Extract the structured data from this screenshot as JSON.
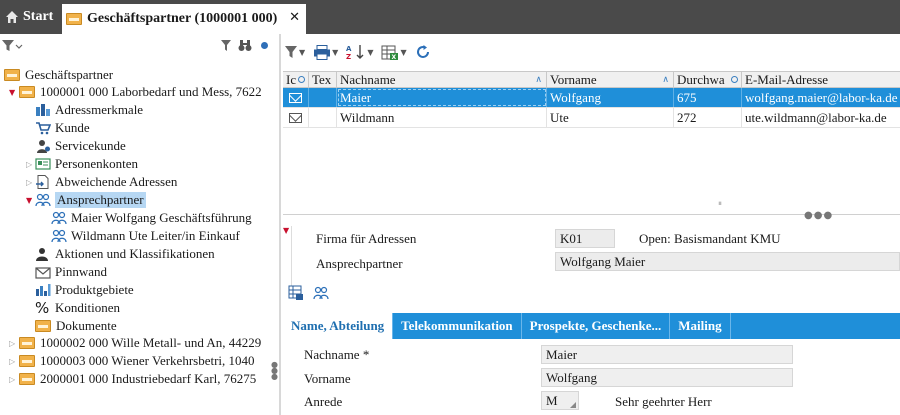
{
  "tabs": {
    "start_label": "Start",
    "active_label": "Geschäftspartner (1000001 000)",
    "close_glyph": "✕"
  },
  "tree": {
    "root": "Geschäftspartner",
    "partner1": "1000001  000  Laborbedarf und Mess, 7622",
    "children": {
      "adressmerkmale": "Adressmerkmale",
      "kunde": "Kunde",
      "servicekunde": "Servicekunde",
      "personenkonten": "Personenkonten",
      "abweichende_adressen": "Abweichende Adressen",
      "ansprechpartner": "Ansprechpartner",
      "contact1": "Maier  Wolfgang  Geschäftsführung",
      "contact2": "Wildmann  Ute  Leiter/in Einkauf",
      "aktionen": "Aktionen und Klassifikationen",
      "pinnwand": "Pinnwand",
      "produktgebiete": "Produktgebiete",
      "konditionen": "Konditionen",
      "dokumente": "Dokumente"
    },
    "partner2": "1000002  000  Wille Metall- und An, 44229",
    "partner3": "1000003  000  Wiener Verkehrsbetri, 1040",
    "partner4": "2000001  000  Industriebedarf Karl, 76275"
  },
  "grid": {
    "headers": {
      "ic": "Ic",
      "tex": "Tex",
      "nachname": "Nachname",
      "vorname": "Vorname",
      "durchwahl": "Durchwa",
      "email": "E-Mail-Adresse"
    },
    "rows": [
      {
        "nachname": "Maier",
        "vorname": "Wolfgang",
        "durchwahl": "675",
        "email": "wolfgang.maier@labor-ka.de"
      },
      {
        "nachname": "Wildmann",
        "vorname": "Ute",
        "durchwahl": "272",
        "email": "ute.wildmann@labor-ka.de"
      }
    ],
    "scroll_marker": "⏸"
  },
  "detail": {
    "firma_label": "Firma für Adressen",
    "firma_code": "K01",
    "firma_desc": "Open: Basismandant KMU",
    "ansprech_label": "Ansprechpartner",
    "ansprech_value": "Wolfgang Maier"
  },
  "bottom_tabs": [
    "Name, Abteilung",
    "Telekommunikation",
    "Prospekte, Geschenke...",
    "Mailing"
  ],
  "form": {
    "nachname_label": "Nachname *",
    "nachname_value": "Maier",
    "vorname_label": "Vorname",
    "vorname_value": "Wolfgang",
    "anrede_label": "Anrede",
    "anrede_value": "M",
    "anrede_desc": "Sehr geehrter Herr"
  },
  "colors": {
    "accent": "#1f8fd9",
    "tabbar": "#4a4a4a",
    "selection_tree": "#b6d7f3"
  }
}
